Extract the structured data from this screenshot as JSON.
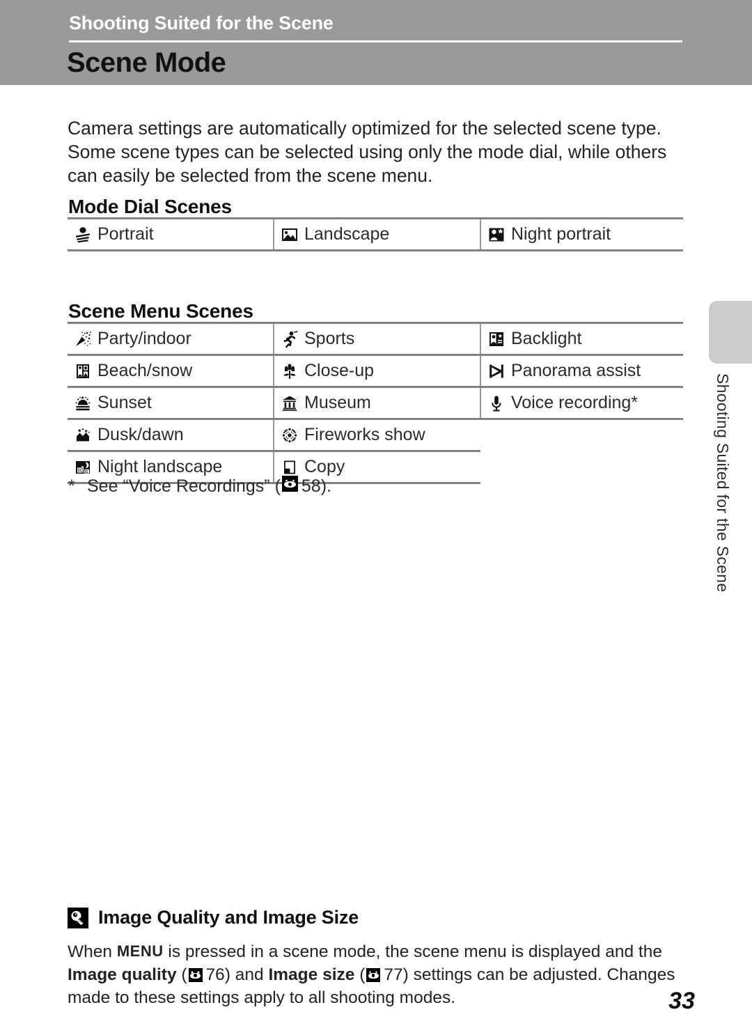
{
  "header": {
    "chapter": "Shooting Suited for the Scene",
    "title": "Scene Mode",
    "banner_color": "#9a9a9a"
  },
  "intro": "Camera settings are automatically optimized for the selected scene type. Some scene types can be selected using only the mode dial, while others can easily be selected from the scene menu.",
  "sections": {
    "mode_dial": {
      "heading": "Mode Dial Scenes",
      "rows": [
        [
          {
            "icon": "portrait-icon",
            "label": "Portrait"
          },
          {
            "icon": "landscape-icon",
            "label": "Landscape"
          },
          {
            "icon": "night-portrait-icon",
            "label": "Night portrait"
          }
        ]
      ]
    },
    "scene_menu": {
      "heading": "Scene Menu Scenes",
      "rows": [
        [
          {
            "icon": "party-indoor-icon",
            "label": "Party/indoor"
          },
          {
            "icon": "sports-icon",
            "label": "Sports"
          },
          {
            "icon": "backlight-icon",
            "label": "Backlight"
          }
        ],
        [
          {
            "icon": "beach-snow-icon",
            "label": "Beach/snow"
          },
          {
            "icon": "close-up-icon",
            "label": "Close-up"
          },
          {
            "icon": "panorama-assist-icon",
            "label": "Panorama assist"
          }
        ],
        [
          {
            "icon": "sunset-icon",
            "label": "Sunset"
          },
          {
            "icon": "museum-icon",
            "label": "Museum"
          },
          {
            "icon": "voice-recording-icon",
            "label": "Voice recording*"
          }
        ],
        [
          {
            "icon": "dusk-dawn-icon",
            "label": "Dusk/dawn"
          },
          {
            "icon": "fireworks-icon",
            "label": "Fireworks show"
          },
          {
            "icon": "",
            "label": ""
          }
        ],
        [
          {
            "icon": "night-landscape-icon",
            "label": "Night landscape"
          },
          {
            "icon": "copy-icon",
            "label": "Copy"
          },
          {
            "icon": "",
            "label": ""
          }
        ]
      ]
    }
  },
  "footnote": {
    "marker": "*",
    "text_before": "See “Voice Recordings” (",
    "page": "58",
    "text_after": ")."
  },
  "side_tab": {
    "label": "Shooting Suited for the Scene",
    "color": "#cbcbcb"
  },
  "tip": {
    "icon": "lightbulb-icon",
    "title": "Image Quality and Image Size",
    "part1": "When ",
    "menu_key": "MENU",
    "part2": " is pressed in a scene mode, the scene menu is displayed and the ",
    "bold1": "Image quality",
    "part3": " (",
    "page1": "76",
    "part4": ") and ",
    "bold2": "Image size",
    "part5": " (",
    "page2": "77",
    "part6": ") settings can be adjusted. Changes made to these settings apply to all shooting modes."
  },
  "page_number": "33"
}
